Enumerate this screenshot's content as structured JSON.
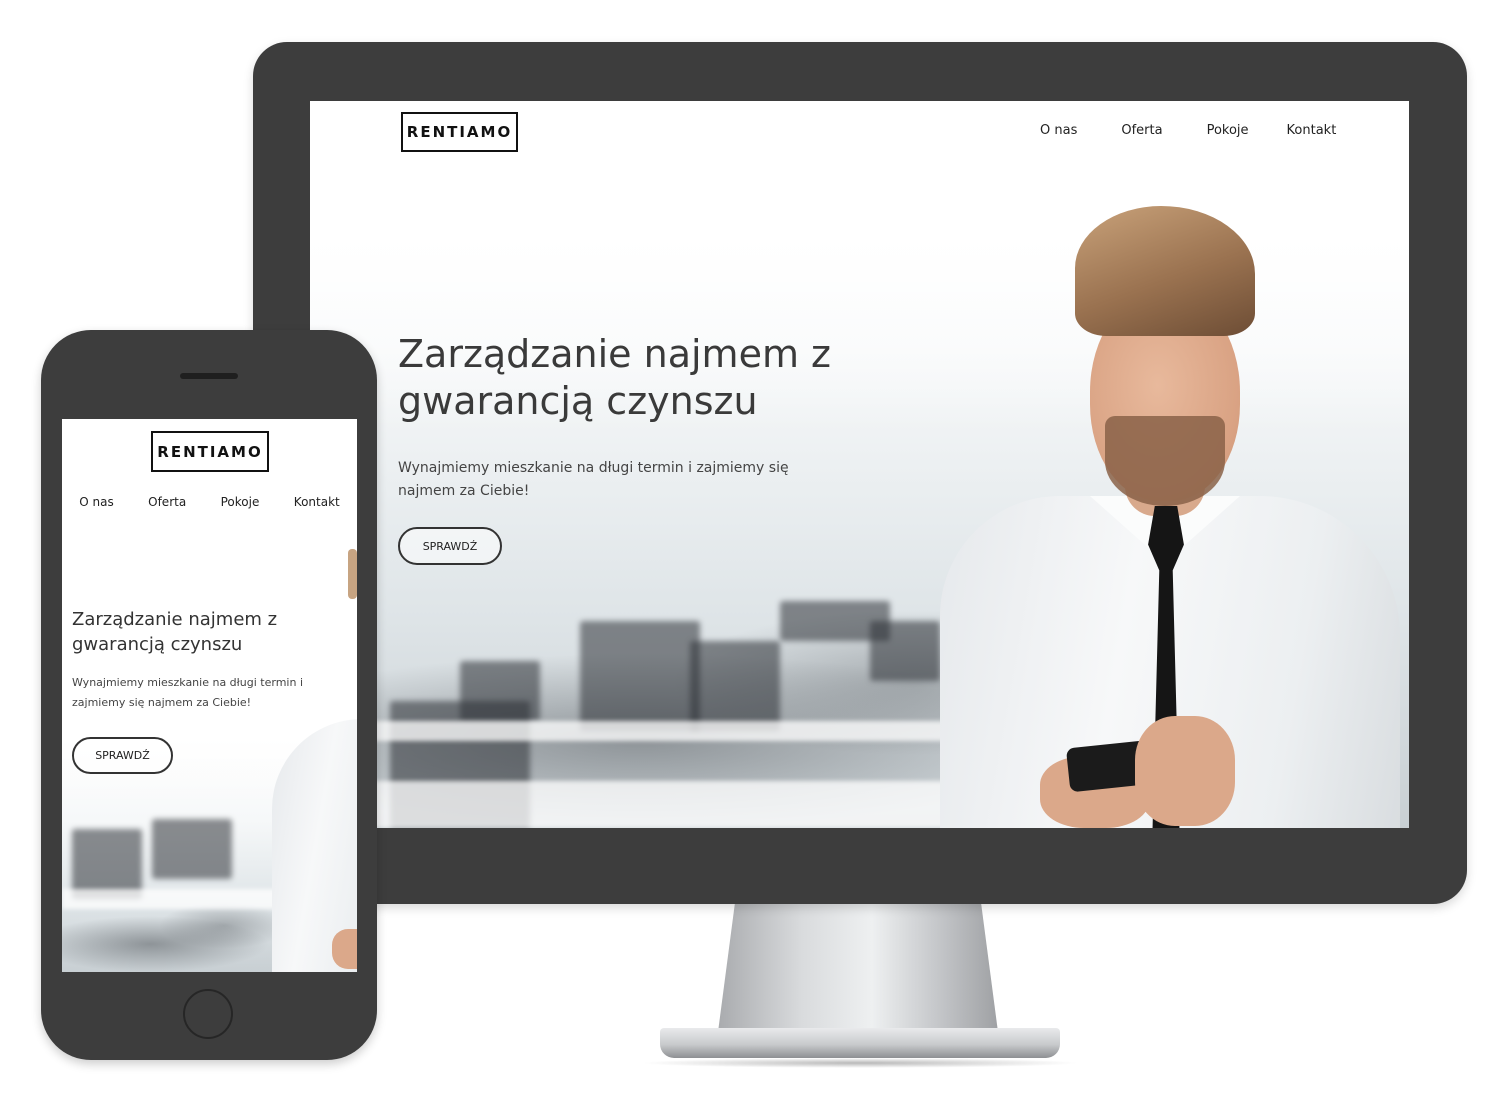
{
  "brand": {
    "logo_text": "RENTIAMO"
  },
  "nav": {
    "items": [
      {
        "label": "O nas"
      },
      {
        "label": "Oferta"
      },
      {
        "label": "Pokoje"
      },
      {
        "label": "Kontakt"
      }
    ]
  },
  "hero": {
    "title": "Zarządzanie najmem z gwarancją czynszu",
    "subtitle": "Wynajmiemy mieszkanie na długi termin i zajmiemy się najmem za Ciebie!",
    "cta_label": "SPRAWDŹ"
  },
  "colors": {
    "device_frame": "#3d3d3d",
    "text_dark": "#333333",
    "background": "#ffffff"
  }
}
